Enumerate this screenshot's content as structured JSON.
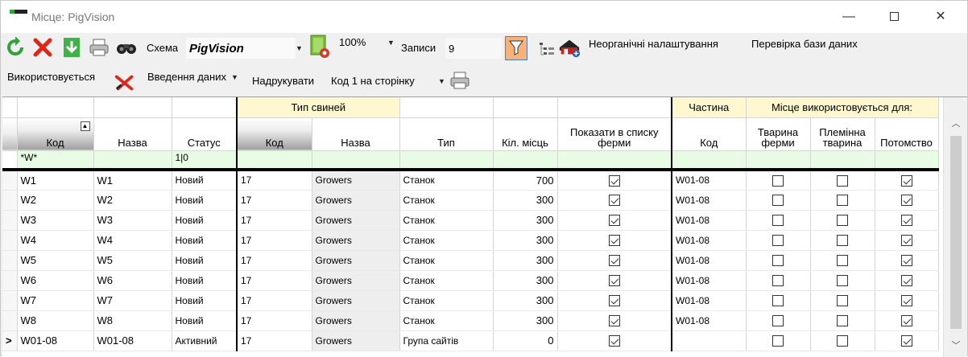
{
  "window": {
    "title": "Місце: PigVision",
    "min_glyph": "—",
    "close_glyph": "✕"
  },
  "toolbar1": {
    "schema_label": "Схема",
    "schema_value": "PigVision",
    "zoom_value": "100%",
    "records_label": "Записи",
    "records_value": "9",
    "unlimited_settings": "Неорганічні налаштування",
    "check_database": "Перевірка бази даних"
  },
  "toolbar2": {
    "in_use_label": "Використовується",
    "data_entry_label": "Введення даних",
    "print_label": "Надрукувати",
    "print_mode_value": "Код 1 на сторінку"
  },
  "grid": {
    "group_headers": {
      "pig_type": "Тип свиней",
      "part": "Частина",
      "place_used_for": "Місце використовується для:"
    },
    "columns": {
      "code": "Код",
      "name": "Назва",
      "status": "Статус",
      "pig_code": "Код",
      "pig_name": "Назва",
      "type": "Тип",
      "places": "Кіл. місць",
      "show_in_farm_list": "Показати в списку ферми",
      "part_code": "Код",
      "farm_animal": "Тварина ферми",
      "breeding_animal": "Племінна тварина",
      "offspring": "Потомство"
    },
    "filter_row": {
      "code": "*W*",
      "status": "1|0"
    },
    "current_row_marker": ">",
    "rows": [
      {
        "code": "W1",
        "name": "W1",
        "status": "Новий",
        "pig_code": "17",
        "pig_name": "Growers",
        "type": "Станок",
        "places": "700",
        "show": true,
        "part": "W01-08",
        "farm": false,
        "breeding": false,
        "offspring": true
      },
      {
        "code": "W2",
        "name": "W2",
        "status": "Новий",
        "pig_code": "17",
        "pig_name": "Growers",
        "type": "Станок",
        "places": "300",
        "show": true,
        "part": "W01-08",
        "farm": false,
        "breeding": false,
        "offspring": true
      },
      {
        "code": "W3",
        "name": "W3",
        "status": "Новий",
        "pig_code": "17",
        "pig_name": "Growers",
        "type": "Станок",
        "places": "300",
        "show": true,
        "part": "W01-08",
        "farm": false,
        "breeding": false,
        "offspring": true
      },
      {
        "code": "W4",
        "name": "W4",
        "status": "Новий",
        "pig_code": "17",
        "pig_name": "Growers",
        "type": "Станок",
        "places": "300",
        "show": true,
        "part": "W01-08",
        "farm": false,
        "breeding": false,
        "offspring": true
      },
      {
        "code": "W5",
        "name": "W5",
        "status": "Новий",
        "pig_code": "17",
        "pig_name": "Growers",
        "type": "Станок",
        "places": "300",
        "show": true,
        "part": "W01-08",
        "farm": false,
        "breeding": false,
        "offspring": true
      },
      {
        "code": "W6",
        "name": "W6",
        "status": "Новий",
        "pig_code": "17",
        "pig_name": "Growers",
        "type": "Станок",
        "places": "300",
        "show": true,
        "part": "W01-08",
        "farm": false,
        "breeding": false,
        "offspring": true
      },
      {
        "code": "W7",
        "name": "W7",
        "status": "Новий",
        "pig_code": "17",
        "pig_name": "Growers",
        "type": "Станок",
        "places": "300",
        "show": true,
        "part": "W01-08",
        "farm": false,
        "breeding": false,
        "offspring": true
      },
      {
        "code": "W8",
        "name": "W8",
        "status": "Новий",
        "pig_code": "17",
        "pig_name": "Growers",
        "type": "Станок",
        "places": "300",
        "show": true,
        "part": "W01-08",
        "farm": false,
        "breeding": false,
        "offspring": true
      },
      {
        "code": "W01-08",
        "name": "W01-08",
        "status": "Активний",
        "pig_code": "17",
        "pig_name": "Growers",
        "type": "Група сайтів",
        "places": "0",
        "show": true,
        "part": "",
        "farm": false,
        "breeding": false,
        "offspring": true
      }
    ]
  }
}
